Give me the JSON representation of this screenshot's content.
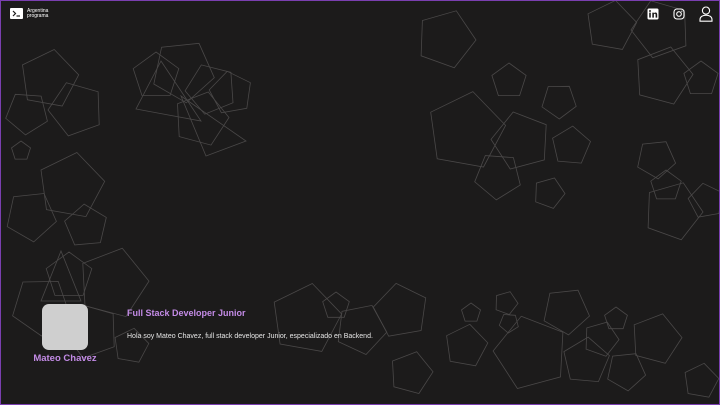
{
  "brand": {
    "logo_line1": "Argentina",
    "logo_line2": "programa"
  },
  "nav": {
    "icons": [
      "linkedin-icon",
      "instagram-icon",
      "user-icon"
    ]
  },
  "profile": {
    "name": "Mateo Chavez",
    "title": "Full Stack Developer Junior",
    "bio": "Hola soy Mateo Chavez, full stack developer Junior, especializado en Backend."
  },
  "colors": {
    "background": "#1c1b1b",
    "accent": "#c38be6",
    "border": "#7a3fb0",
    "shape_stroke": "#4a4848"
  }
}
